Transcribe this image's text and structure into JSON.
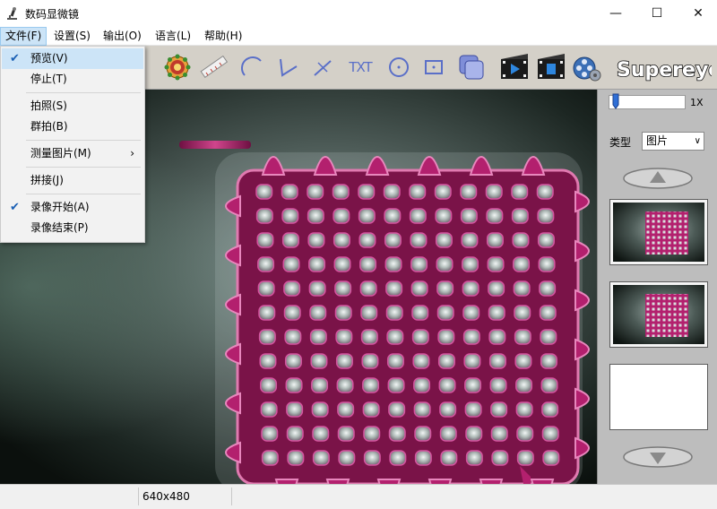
{
  "window": {
    "title": "数码显微镜",
    "min_glyph": "—",
    "max_glyph": "☐",
    "close_glyph": "✕"
  },
  "menubar": {
    "items": [
      {
        "label": "文件(F)",
        "active": true
      },
      {
        "label": "设置(S)"
      },
      {
        "label": "输出(O)"
      },
      {
        "label": "语言(L)"
      },
      {
        "label": "帮助(H)"
      }
    ]
  },
  "file_menu": {
    "items": [
      {
        "label": "预览(V)",
        "checked": true
      },
      {
        "label": "停止(T)"
      },
      {
        "label": "拍照(S)"
      },
      {
        "label": "群拍(B)"
      },
      {
        "label": "测量图片(M)",
        "submenu_arrow": "›"
      },
      {
        "label": "拼接(J)"
      },
      {
        "label": "录像开始(A)",
        "checked": true
      },
      {
        "label": "录像结束(P)"
      }
    ],
    "check_glyph": "✔"
  },
  "toolbar": {
    "icons": [
      "settings-gear-icon",
      "ruler-icon",
      "arc-icon",
      "angle-icon",
      "line-icon",
      "text-icon",
      "circle-icon",
      "rectangle-icon",
      "layers-icon",
      "video-record-icon",
      "video-stop-icon",
      "film-settings-icon"
    ],
    "text_tool_label": "TXT",
    "brand": "Supereyes"
  },
  "side_panel": {
    "zoom_label": "1X",
    "zoom_level": 0.05,
    "type_label": "类型",
    "type_value": "图片",
    "type_caret": "∨"
  },
  "status": {
    "resolution": "640x480"
  },
  "colors": {
    "accent_highlight": "#cce4f7",
    "toolbar_bg": "#d4d0c8",
    "panel_bg": "#bdbdbd",
    "sample_magenta": "#b3206e",
    "icon_blue": "#5a6fc8"
  }
}
